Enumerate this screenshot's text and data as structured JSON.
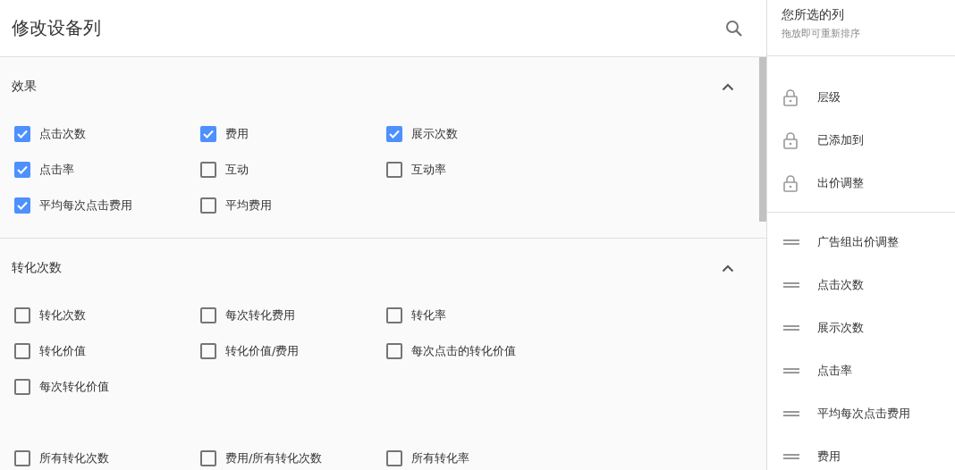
{
  "title": "修改设备列",
  "sections": [
    {
      "title": "效果",
      "expanded": true,
      "groups": [
        [
          {
            "label": "点击次数",
            "checked": true
          },
          {
            "label": "费用",
            "checked": true
          },
          {
            "label": "展示次数",
            "checked": true
          },
          {
            "label": "点击率",
            "checked": true
          },
          {
            "label": "互动",
            "checked": false
          },
          {
            "label": "互动率",
            "checked": false
          },
          {
            "label": "平均每次点击费用",
            "checked": true
          },
          {
            "label": "平均费用",
            "checked": false
          }
        ]
      ]
    },
    {
      "title": "转化次数",
      "expanded": true,
      "groups": [
        [
          {
            "label": "转化次数",
            "checked": false
          },
          {
            "label": "每次转化费用",
            "checked": false
          },
          {
            "label": "转化率",
            "checked": false
          },
          {
            "label": "转化价值",
            "checked": false
          },
          {
            "label": "转化价值/费用",
            "checked": false
          },
          {
            "label": "每次点击的转化价值",
            "checked": false
          },
          {
            "label": "每次转化价值",
            "checked": false
          }
        ],
        [
          {
            "label": "所有转化次数",
            "checked": false
          },
          {
            "label": "费用/所有转化次数",
            "checked": false
          },
          {
            "label": "所有转化率",
            "checked": false
          }
        ]
      ]
    }
  ],
  "selected_panel": {
    "title": "您所选的列",
    "subtitle": "拖放即可重新排序",
    "locked": [
      {
        "label": "层级"
      },
      {
        "label": "已添加到"
      },
      {
        "label": "出价调整"
      }
    ],
    "movable": [
      {
        "label": "广告组出价调整"
      },
      {
        "label": "点击次数"
      },
      {
        "label": "展示次数"
      },
      {
        "label": "点击率"
      },
      {
        "label": "平均每次点击费用"
      },
      {
        "label": "费用"
      }
    ]
  }
}
